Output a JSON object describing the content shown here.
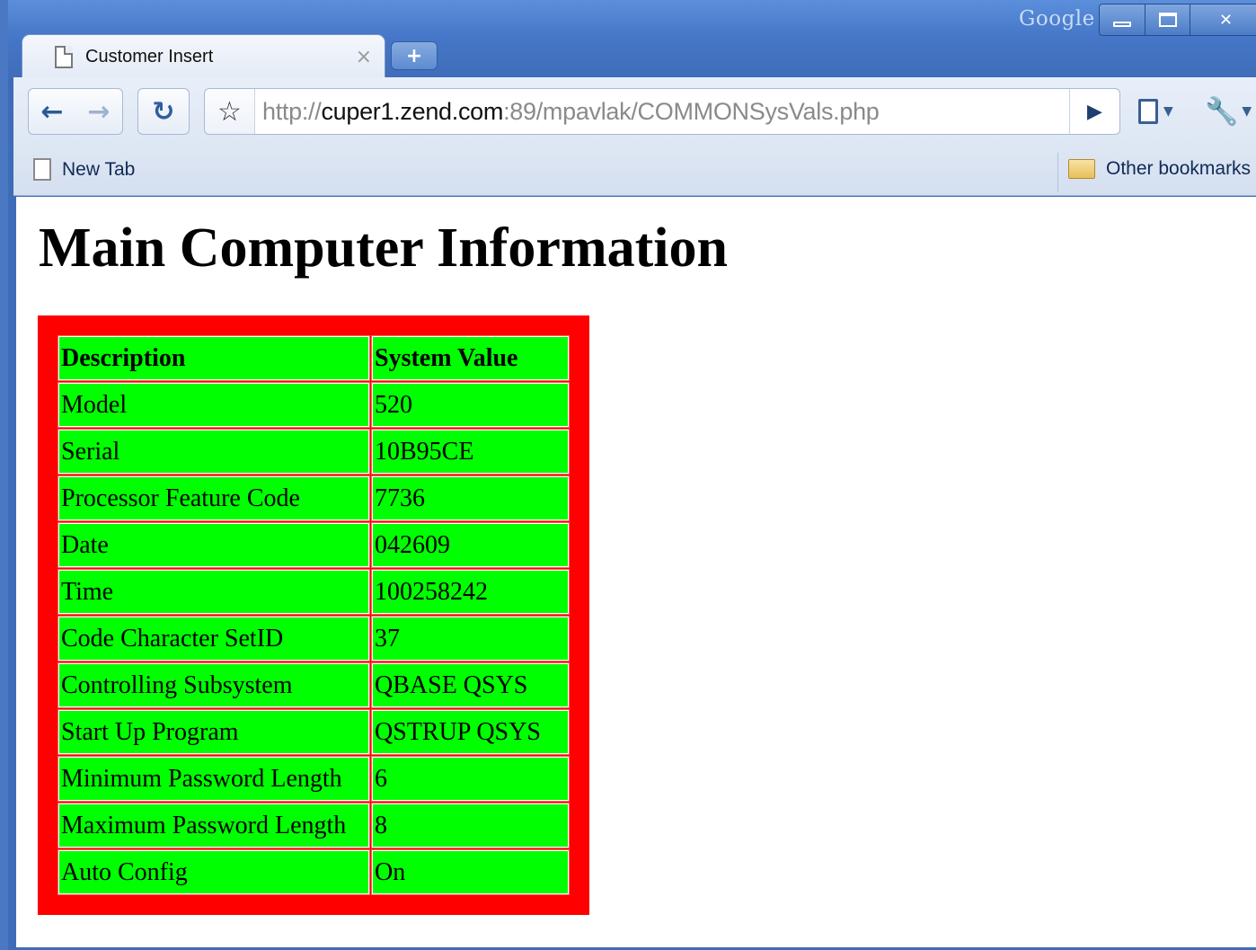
{
  "browser": {
    "brand_label": "Google",
    "tab": {
      "title": "Customer Insert",
      "close_glyph": "×"
    },
    "new_tab_glyph": "+",
    "url": {
      "scheme": "http://",
      "host": "cuper1.zend.com",
      "rest": ":89/mpavlak/COMMONSysVals.php"
    },
    "bookmarks": [
      {
        "label": "New Tab"
      }
    ],
    "other_bookmarks_label": "Other bookmarks"
  },
  "page": {
    "heading": "Main Computer Information",
    "table": {
      "headers": [
        "Description",
        "System Value"
      ],
      "rows": [
        [
          "Model",
          "520"
        ],
        [
          "Serial",
          "10B95CE"
        ],
        [
          "Processor Feature Code",
          "7736"
        ],
        [
          "Date",
          "042609"
        ],
        [
          "Time",
          "100258242"
        ],
        [
          "Code Character SetID",
          "37"
        ],
        [
          "Controlling Subsystem",
          "QBASE QSYS"
        ],
        [
          "Start Up Program",
          "QSTRUP QSYS"
        ],
        [
          "Minimum Password Length",
          "6"
        ],
        [
          "Maximum Password Length",
          "8"
        ],
        [
          "Auto Config",
          "On"
        ]
      ]
    }
  },
  "colors": {
    "table_frame": "#ff0000",
    "cell_background": "#00ff00",
    "window_frame": "#4a78c2"
  },
  "icons": [
    "page-icon",
    "back-arrow-icon",
    "forward-arrow-icon",
    "reload-icon",
    "star-icon",
    "go-arrow-icon",
    "page-menu-icon",
    "wrench-icon",
    "folder-icon",
    "minimize-icon",
    "maximize-icon",
    "close-icon"
  ]
}
